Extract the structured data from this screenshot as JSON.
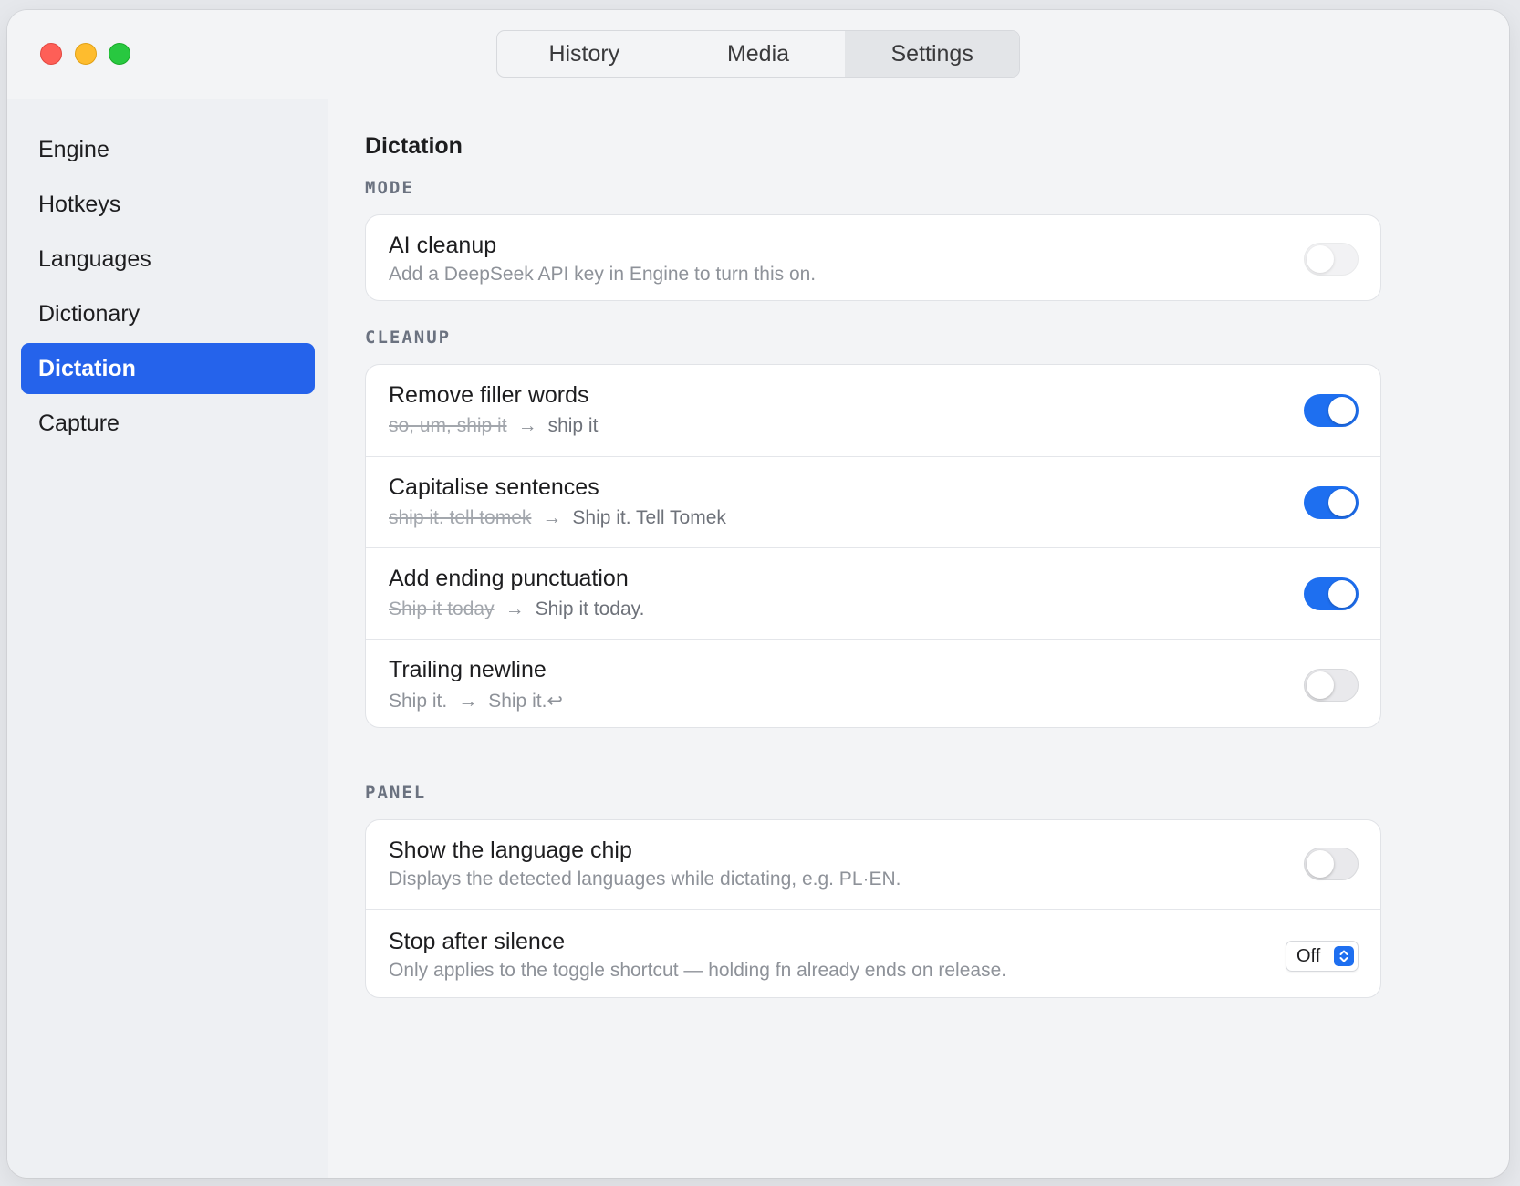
{
  "tabs": [
    {
      "label": "History",
      "active": false
    },
    {
      "label": "Media",
      "active": false
    },
    {
      "label": "Settings",
      "active": true
    }
  ],
  "sidebar": {
    "items": [
      {
        "label": "Engine",
        "active": false
      },
      {
        "label": "Hotkeys",
        "active": false
      },
      {
        "label": "Languages",
        "active": false
      },
      {
        "label": "Dictionary",
        "active": false
      },
      {
        "label": "Dictation",
        "active": true
      },
      {
        "label": "Capture",
        "active": false
      }
    ]
  },
  "page": {
    "title": "Dictation"
  },
  "sections": {
    "mode": {
      "label": "MODE",
      "ai_cleanup": {
        "title": "AI cleanup",
        "subtitle": "Add a DeepSeek API key in Engine to turn this on.",
        "on": false,
        "disabled": true
      }
    },
    "cleanup": {
      "label": "CLEANUP",
      "rows": [
        {
          "title": "Remove filler words",
          "before": "so, um, ship it",
          "arrow": "→",
          "after": "ship it",
          "on": true
        },
        {
          "title": "Capitalise sentences",
          "before": "ship it. tell tomek",
          "arrow": "→",
          "after": "Ship it. Tell Tomek",
          "on": true
        },
        {
          "title": "Add ending punctuation",
          "before": "Ship it today",
          "arrow": "→",
          "after": "Ship it today.",
          "on": true
        },
        {
          "title": "Trailing newline",
          "before": "Ship it.",
          "arrow": "→",
          "after": "Ship it.↩",
          "on": false
        }
      ]
    },
    "panel": {
      "label": "PANEL",
      "language_chip": {
        "title": "Show the language chip",
        "subtitle": "Displays the detected languages while dictating, e.g. PL·EN.",
        "on": false
      },
      "stop_after_silence": {
        "title": "Stop after silence",
        "subtitle": "Only applies to the toggle shortcut — holding fn already ends on release.",
        "value": "Off"
      }
    }
  },
  "colors": {
    "accent": "#2563eb",
    "toggle_on": "#1e6ff0",
    "traffic_close": "#fe5f57",
    "traffic_minimize": "#febc2e",
    "traffic_maximize": "#28c840"
  }
}
